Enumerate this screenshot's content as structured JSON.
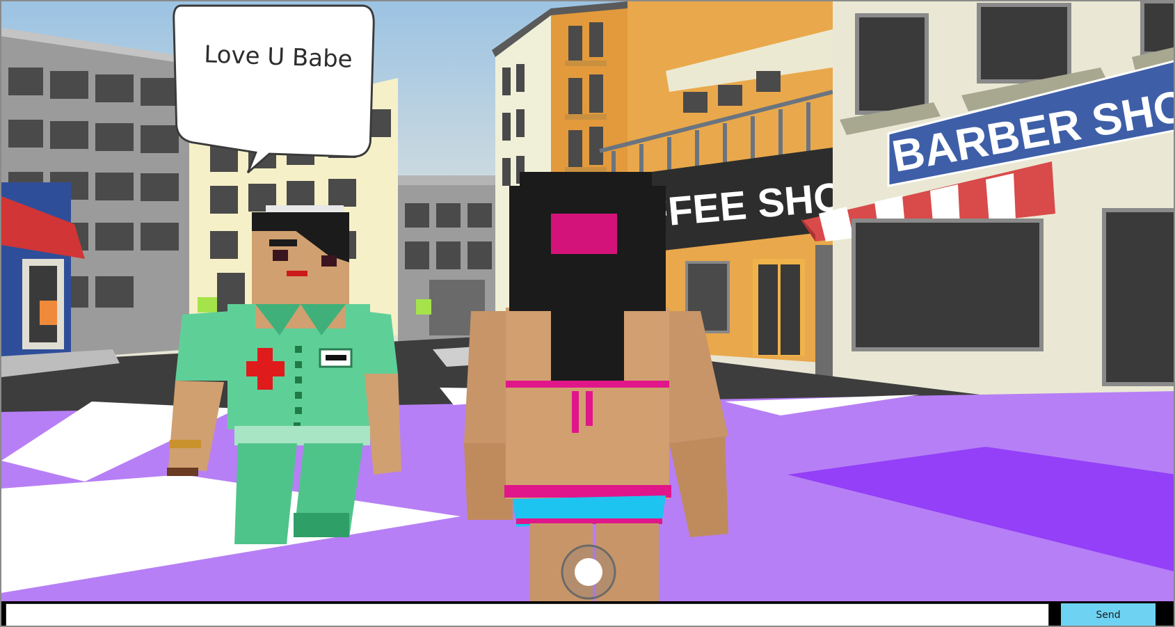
{
  "speech_bubble": {
    "text": "Love U Babe"
  },
  "signs": {
    "coffee_shop": "FFEE SHOP",
    "barber_shop": "BARBER SHO"
  },
  "chat": {
    "input_value": "",
    "input_placeholder": "",
    "send_label": "Send"
  },
  "colors": {
    "sky_top": "#9cc3e3",
    "sky_bottom": "#e9e4d2",
    "floor_purple": "#b77ff5",
    "floor_dark_purple": "#9340f8",
    "send_button": "#6ed3f3",
    "nurse_scrubs": "#5fcf98",
    "barber_sign": "#3e5fa8"
  },
  "icons": {
    "joystick": "virtual-joystick-icon",
    "cross": "red-cross-icon"
  }
}
